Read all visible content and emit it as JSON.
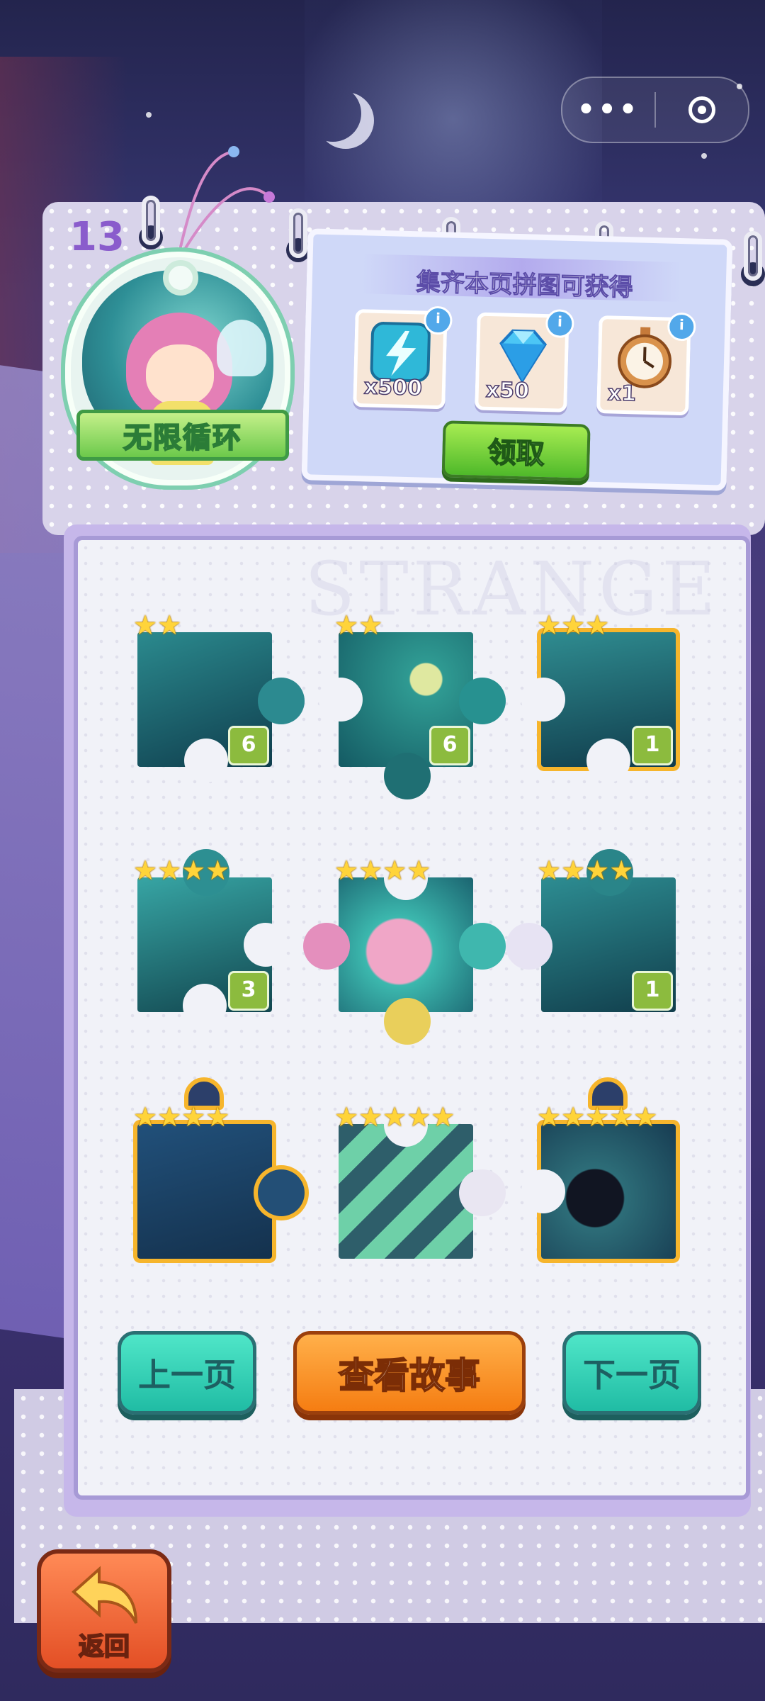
{
  "capsule": {
    "more_icon": "more-dots-icon",
    "close_icon": "target-circle-icon"
  },
  "chapter": {
    "number": "13",
    "name": "无限循环"
  },
  "reward": {
    "title": "集齐本页拼图可获得",
    "items": [
      {
        "icon": "lightning-energy-icon",
        "qty": "x500"
      },
      {
        "icon": "blue-diamond-icon",
        "qty": "x50"
      },
      {
        "icon": "stopwatch-icon",
        "qty": "x1"
      }
    ],
    "info_icon": "info-icon",
    "claim_label": "领取"
  },
  "watermark": "STRANGE",
  "pieces": [
    {
      "stars": "★★",
      "count": "6"
    },
    {
      "stars": "★★",
      "count": "6"
    },
    {
      "stars": "★★★",
      "count": "1"
    },
    {
      "stars": "★★★★",
      "count": "3"
    },
    {
      "stars": "★★★★",
      "count": ""
    },
    {
      "stars": "★★★★",
      "count": "1"
    },
    {
      "stars": "★★★★",
      "count": ""
    },
    {
      "stars": "★★★★★",
      "count": ""
    },
    {
      "stars": "★★★★★",
      "count": ""
    }
  ],
  "buttons": {
    "prev": "上一页",
    "story": "查看故事",
    "next": "下一页",
    "back": "返回"
  },
  "colors": {
    "star": "#ffd43a",
    "count_badge": "#8cbb3e",
    "teal_button": "#20bca4",
    "orange_button": "#f57d12",
    "gold_frame": "#f6b52c"
  }
}
